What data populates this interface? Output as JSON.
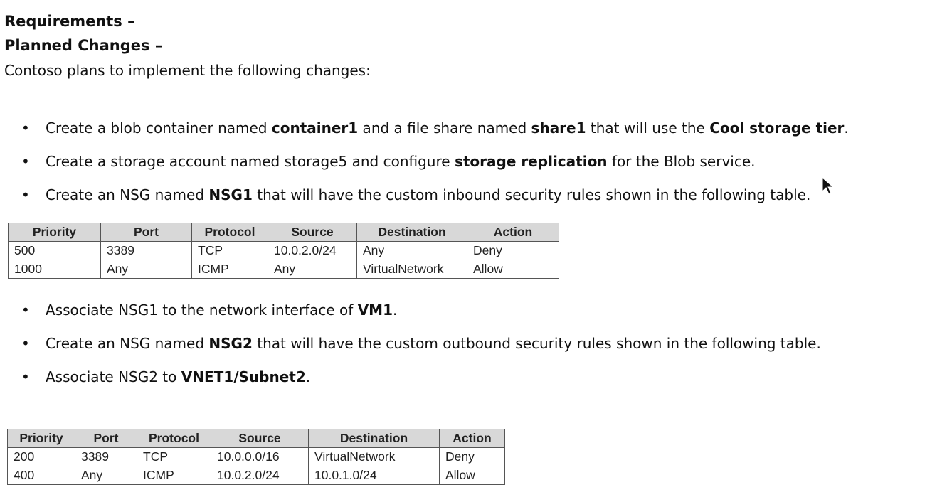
{
  "headings": {
    "requirements": "Requirements –",
    "planned_changes": "Planned Changes –"
  },
  "intro": "Contoso plans to implement the following changes:",
  "bullet_symbol": "•",
  "bullets": [
    [
      {
        "t": "Create a blob container named ",
        "b": false
      },
      {
        "t": "container1",
        "b": true
      },
      {
        "t": " and a file share named ",
        "b": false
      },
      {
        "t": "share1",
        "b": true
      },
      {
        "t": " that will use the ",
        "b": false
      },
      {
        "t": "Cool storage tier",
        "b": true
      },
      {
        "t": ".",
        "b": false
      }
    ],
    [
      {
        "t": "Create a storage account named storage5 and configure ",
        "b": false
      },
      {
        "t": "storage replication",
        "b": true
      },
      {
        "t": " for the Blob service.",
        "b": false
      }
    ],
    [
      {
        "t": "Create an NSG named ",
        "b": false
      },
      {
        "t": "NSG1",
        "b": true
      },
      {
        "t": " that will have the custom inbound security rules shown in the following table.",
        "b": false
      }
    ],
    [
      {
        "t": "Associate NSG1 to the network interface of ",
        "b": false
      },
      {
        "t": "VM1",
        "b": true
      },
      {
        "t": ".",
        "b": false
      }
    ],
    [
      {
        "t": "Create an NSG named ",
        "b": false
      },
      {
        "t": "NSG2",
        "b": true
      },
      {
        "t": " that will have the custom outbound security rules shown in the following table.",
        "b": false
      }
    ],
    [
      {
        "t": "Associate NSG2 to ",
        "b": false
      },
      {
        "t": "VNET1/Subnet2",
        "b": true
      },
      {
        "t": ".",
        "b": false
      }
    ]
  ],
  "table1": {
    "headers": [
      "Priority",
      "Port",
      "Protocol",
      "Source",
      "Destination",
      "Action"
    ],
    "rows": [
      [
        "500",
        "3389",
        "TCP",
        "10.0.2.0/24",
        "Any",
        "Deny"
      ],
      [
        "1000",
        "Any",
        "ICMP",
        "Any",
        "VirtualNetwork",
        "Allow"
      ]
    ]
  },
  "table2": {
    "headers": [
      "Priority",
      "Port",
      "Protocol",
      "Source",
      "Destination",
      "Action"
    ],
    "rows": [
      [
        "200",
        "3389",
        "TCP",
        "10.0.0.0/16",
        "VirtualNetwork",
        "Deny"
      ],
      [
        "400",
        "Any",
        "ICMP",
        "10.0.2.0/24",
        "10.0.1.0/24",
        "Allow"
      ]
    ]
  },
  "icons": {
    "cursor": "mouse-pointer-icon"
  }
}
